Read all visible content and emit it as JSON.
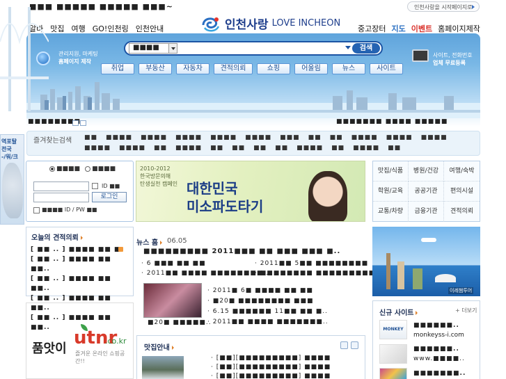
{
  "top": {
    "tagline": "■■■ ■■■■■ ■■■■■ ■■■~",
    "set_start": "인천사랑을 시작페이지로",
    "nav_left": [
      "알바",
      "맛집",
      "여행",
      "GO!인천링",
      "인천안내"
    ],
    "logo_ko": "인천사랑",
    "logo_en": "LOVE INCHEON",
    "nav_right": [
      "중고장터",
      "지도",
      "이벤트",
      "홈페이지제작"
    ]
  },
  "hero": {
    "left_line1": "관리지원, 마케팅",
    "left_line2": "홈페이지 제작",
    "search_select": "■■■■",
    "search_value": "",
    "search_button": "검색",
    "categories": [
      "취업",
      "부동산",
      "자동차",
      "견적의뢰",
      "쇼핑",
      "어울림",
      "뉴스",
      "사이트"
    ],
    "right_line1": "사이트, 전화번호",
    "right_line2": "업체 무료등록"
  },
  "strip": {
    "left": "■■■■■■■■",
    "right": "■■■■■■■ ■■■■ ■■■■■"
  },
  "favorites": {
    "label": "즐겨찾는검색",
    "row1": [
      "■■",
      "■■■■",
      "■■■■",
      "■■■■",
      "■■■■",
      "■■■■",
      "■■■",
      "■■",
      "■■",
      "■■■■",
      "■■■■",
      "■■■■"
    ],
    "row2": [
      "■■■■",
      "■■■■",
      "■■",
      "■■■■",
      "■■",
      "■■",
      "■■",
      "■■",
      "■■■■",
      "■■",
      "■■■■",
      "■■"
    ]
  },
  "side": {
    "line1": "역포탈",
    "line2": "전국",
    "line3": "-/워/크"
  },
  "login": {
    "opt1": "■■■■",
    "opt2": "■■■■",
    "id_save": "ID ■■",
    "login_button": "로그인",
    "bottom": "■■■■ ID / PW ■■"
  },
  "banner": {
    "year": "2010-2012",
    "line2": "한국방문의해",
    "line3": "탄생실천 캠페인",
    "big1": "대한민국",
    "big2": "미소파도타기"
  },
  "quick": [
    "맛집/식품",
    "병원/건강",
    "여행/숙박",
    "학원/교육",
    "공공기관",
    "편의시설",
    "교통/차량",
    "금융기관",
    "견적의뢰"
  ],
  "estimate": {
    "title": "오늘의 견적의뢰",
    "items": [
      "[ ■■ .. ] ■■■■ ■■ ■.",
      "[ ■■ .. ] ■■■■ ■■ ■■..",
      "[ ■■ .. ] ■■■■ ■■ ■■..",
      "[ ■■ .. ] ■■■■ ■■ ■■..",
      "[ ■■ .. ] ■■■■ ■■ ■■.."
    ]
  },
  "ad": {
    "text1": "품앗이",
    "text2": "utnr",
    "text3": ".co.kr",
    "text4": "즐겨운 온라인 쇼핑공간!!"
  },
  "news": {
    "title": "뉴스 홈",
    "date": "06.05",
    "headline": "■■■■■■■■■ 2011■■■ ■■ ■■■ ■■■ ■..",
    "left_items": [
      "6 ■■■ ■■ ■■",
      "2011■■ ■■■■ ■■■■■■■■.."
    ],
    "right_items": [
      "2011■■ 5■■ ■■■■■■■■",
      "■■■■■■■■ ■■■■■■■■■.."
    ],
    "thumb_items": [
      "2011■ 6■ ■■■■ ■■ ■■",
      "■20■ ■■■■■■■■ ■■■",
      "6.15 ■■■■■■ 11■■ ■■ ■..",
      "2011■■ ■■■■ ■■■■■■■.."
    ],
    "thumb_caption": "■20■ ■■■■■.."
  },
  "matjip": {
    "title": "맛집안내",
    "items": [
      "[■■][■■■■■■■■■] ■■■■",
      "[■■][■■■■■■■■■] ■■■■",
      "[■■][■■■■■■■■■] ■■■■"
    ]
  },
  "newsites": {
    "title": "신규 사이트",
    "more": "+ 더보기",
    "items": [
      {
        "name": "■■■■■■..",
        "url": "monkeyss-i.com"
      },
      {
        "name": "■■■■■■..",
        "url": "www.■■■■.."
      },
      {
        "name": "■■■■■■■..",
        "url": ""
      }
    ]
  },
  "tour_label": "이레챔투어"
}
